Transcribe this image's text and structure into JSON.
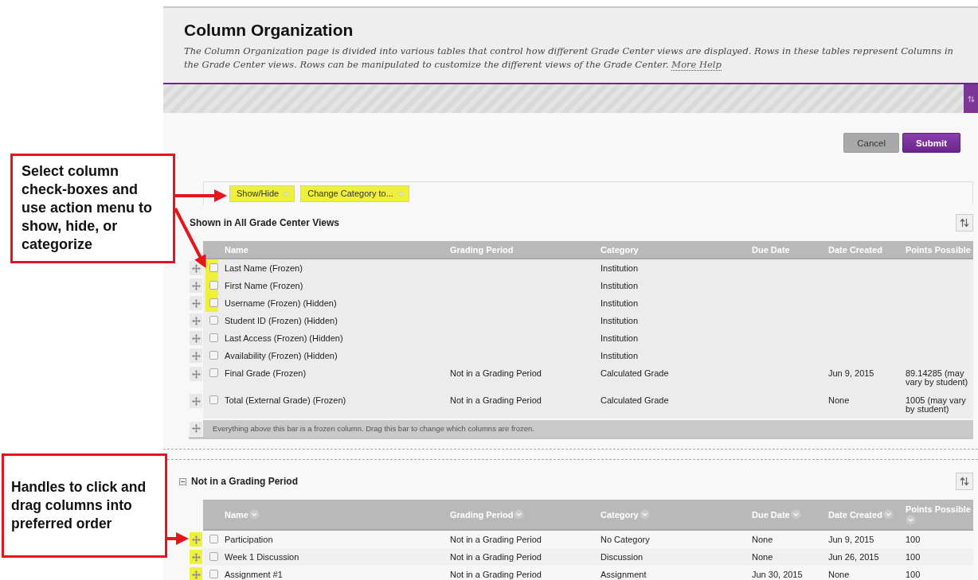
{
  "page": {
    "title": "Column Organization",
    "description": "The Column Organization page is divided into various tables that control how different Grade Center views are displayed. Rows in these tables represent Columns in the Grade Center views. Rows can be manipulated to customize the different views of the Grade Center.",
    "help_link": "More Help"
  },
  "buttons": [
    {
      "label": "Cancel",
      "kind": "secondary"
    },
    {
      "label": "Submit",
      "kind": "primary"
    }
  ],
  "action_bar": [
    {
      "label": "Show/Hide",
      "highlighted": true
    },
    {
      "label": "Change Category to...",
      "highlighted": true
    }
  ],
  "sections": [
    {
      "title": "Shown in All Grade Center Views",
      "sortable": false,
      "columns": [
        "Name",
        "Grading Period",
        "Category",
        "Due Date",
        "Date Created",
        "Points Possible"
      ],
      "rows": [
        {
          "name": "Last Name (Frozen)",
          "category": "Institution",
          "checked": false,
          "checkbox_highlighted": true,
          "handle_highlighted": false
        },
        {
          "name": "First Name (Frozen)",
          "category": "Institution",
          "checked": false,
          "checkbox_highlighted": true,
          "handle_highlighted": false
        },
        {
          "name": "Username (Frozen) (Hidden)",
          "category": "Institution",
          "checked": false,
          "checkbox_highlighted": true,
          "handle_highlighted": false
        },
        {
          "name": "Student ID (Frozen) (Hidden)",
          "category": "Institution",
          "checked": false,
          "checkbox_highlighted": false,
          "handle_highlighted": false
        },
        {
          "name": "Last Access (Frozen) (Hidden)",
          "category": "Institution",
          "checked": false,
          "checkbox_highlighted": false,
          "handle_highlighted": false
        },
        {
          "name": "Availability (Frozen) (Hidden)",
          "category": "Institution",
          "checked": false,
          "checkbox_highlighted": false,
          "handle_highlighted": false
        },
        {
          "name": "Final Grade (Frozen)",
          "grading_period": "Not in a Grading Period",
          "category": "Calculated Grade",
          "date_created": "Jun 9, 2015",
          "points_possible": "89.14285 (may vary by student)",
          "checked": false,
          "checkbox_highlighted": false,
          "handle_highlighted": false
        },
        {
          "name": "Total (External Grade) (Frozen)",
          "grading_period": "Not in a Grading Period",
          "category": "Calculated Grade",
          "date_created": "None",
          "points_possible": "1005 (may vary by student)",
          "checked": false,
          "checkbox_highlighted": false,
          "handle_highlighted": false
        }
      ],
      "frozen_bar": "Everything above this bar is a frozen column. Drag this bar to change which columns are frozen."
    },
    {
      "title": "Not in a Grading Period",
      "expanded": true,
      "sortable": true,
      "columns": [
        "Name",
        "Grading Period",
        "Category",
        "Due Date",
        "Date Created",
        "Points Possible"
      ],
      "rows": [
        {
          "name": "Participation",
          "grading_period": "Not in a Grading Period",
          "category": "No Category",
          "due_date": "None",
          "date_created": "Jun 9, 2015",
          "points_possible": "100",
          "checked": false,
          "checkbox_highlighted": false,
          "handle_highlighted": true
        },
        {
          "name": "Week 1 Discussion",
          "grading_period": "Not in a Grading Period",
          "category": "Discussion",
          "due_date": "None",
          "date_created": "Jun 26, 2015",
          "points_possible": "100",
          "checked": false,
          "checkbox_highlighted": false,
          "handle_highlighted": true
        },
        {
          "name": "Assignment #1",
          "grading_period": "Not in a Grading Period",
          "category": "Assignment",
          "due_date": "Jun 30, 2015",
          "date_created": "None",
          "points_possible": "100",
          "checked": false,
          "checkbox_highlighted": false,
          "handle_highlighted": true
        }
      ]
    }
  ],
  "callouts": [
    {
      "text": "Select column check-boxes and use action menu to show, hide, or categorize"
    },
    {
      "text": "Handles to click and drag columns into preferred order"
    }
  ]
}
